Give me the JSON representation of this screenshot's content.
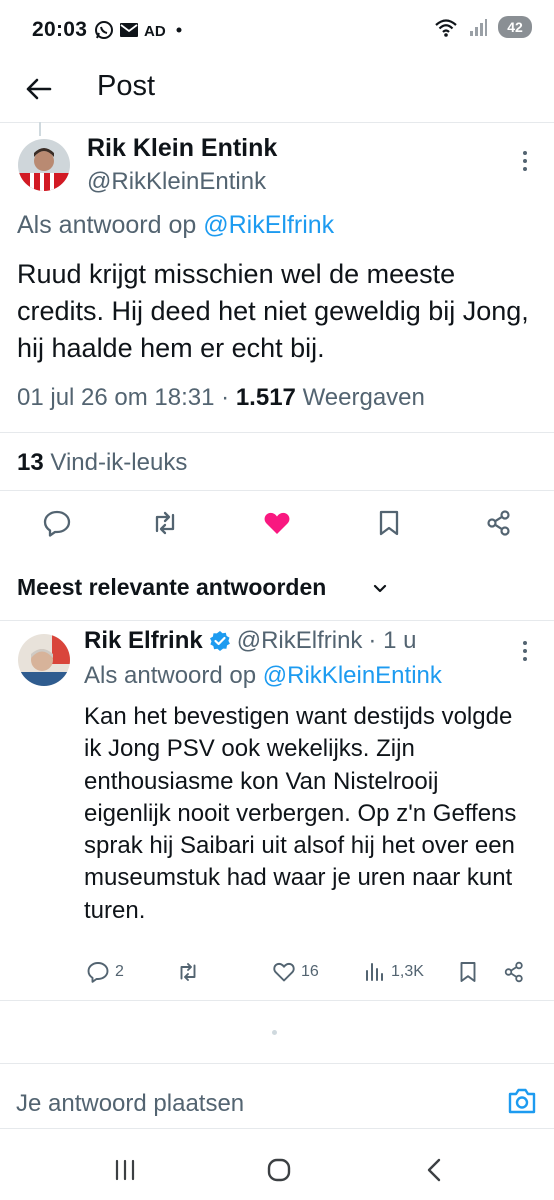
{
  "status_bar": {
    "time": "20:03",
    "left_icons": [
      "whatsapp-icon",
      "mail-icon",
      "ad-icon",
      "dot-icon"
    ],
    "battery": "42"
  },
  "header": {
    "title": "Post"
  },
  "main_post": {
    "author_name": "Rik Klein Entink",
    "author_handle": "@RikKleinEntink",
    "reply_to_prefix": "Als antwoord op",
    "reply_to_handle": "@RikElfrink",
    "text": "Ruud krijgt misschien wel de meeste credits. Hij deed het niet geweldig bij Jong, hij haalde hem er echt bij.",
    "timestamp": "01 jul 26 om 18:31",
    "meta_sep": "·",
    "views_count": "1.517",
    "views_label": "Weergaven",
    "likes_count": "13",
    "likes_label": "Vind-ik-leuks",
    "liked": true,
    "like_color": "#f91880"
  },
  "sort": {
    "label": "Meest relevante antwoorden"
  },
  "reply": {
    "author_name": "Rik Elfrink",
    "verified": true,
    "verified_color": "#1d9bf0",
    "author_handle": "@RikElfrink",
    "age": "· 1 u",
    "reply_to_prefix": "Als antwoord op",
    "reply_to_handle": "@RikKleinEntink",
    "text": "Kan het bevestigen want destijds volgde ik Jong PSV ook wekelijks. Zijn enthousiasme kon Van Nistelrooij eigenlijk nooit verbergen. Op z'n Geffens sprak hij Saibari uit alsof hij het over een museumstuk had waar je uren naar kunt turen.",
    "replies": "2",
    "reposts": "",
    "likes": "16",
    "views": "1,3K"
  },
  "composer": {
    "placeholder": "Je antwoord plaatsen"
  },
  "colors": {
    "accent": "#1d9bf0",
    "text": "#0f1419",
    "muted": "#536471"
  }
}
